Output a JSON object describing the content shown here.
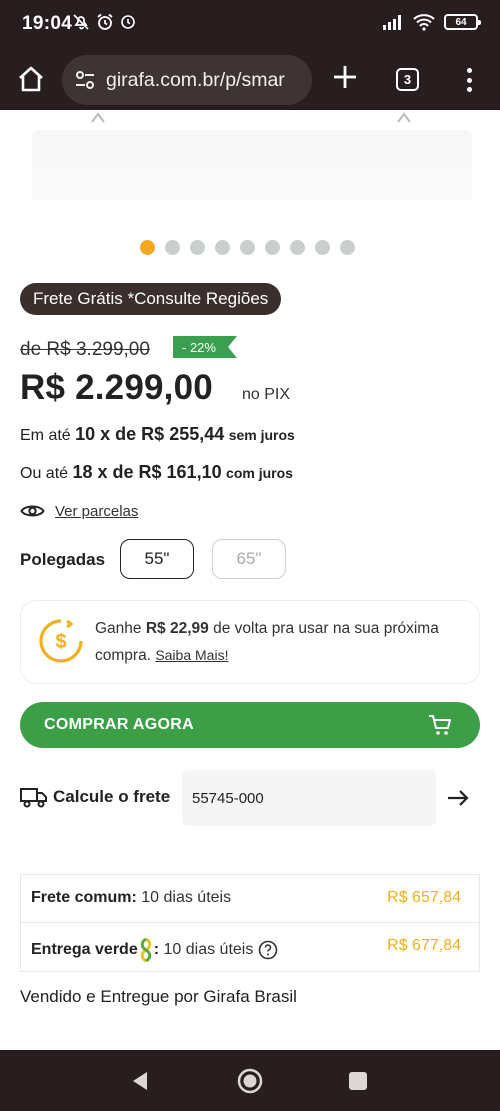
{
  "status_bar": {
    "time": "19:04",
    "battery": "64"
  },
  "browser": {
    "url": "girafa.com.br/p/smar",
    "tab_count": "3"
  },
  "product": {
    "carousel": {
      "dot_count": 9,
      "active_index": 0
    },
    "shipping_badge": "Frete Grátis *Consulte Regiões",
    "old_price": "de R$ 3.299,00",
    "discount": "- 22%",
    "price": "R$ 2.299,00",
    "price_suffix": "no PIX",
    "installments": [
      {
        "prefix": "Em até",
        "amount": "10 x de R$ 255,44",
        "suffix": "sem juros"
      },
      {
        "prefix": "Ou até",
        "amount": "18 x de R$ 161,10",
        "suffix": "com juros"
      }
    ],
    "see_installments": "Ver parcelas",
    "size_label": "Polegadas",
    "sizes": [
      {
        "label": "55\"",
        "selected": true
      },
      {
        "label": "65\"",
        "selected": false
      }
    ],
    "cashback": {
      "text_before": "Ganhe",
      "amount": "R$ 22,99",
      "text_after": "de volta pra usar na sua próxima compra.",
      "link": "Saiba Mais!"
    },
    "buy_button": "COMPRAR AGORA",
    "shipping_calc": {
      "label": "Calcule o frete",
      "cep_value": "55745-000"
    },
    "shipping_options": [
      {
        "name": "Frete comum:",
        "time": "10 dias úteis",
        "price": "R$ 657,84",
        "eco": false
      },
      {
        "name": "Entrega verde",
        "time": "10 dias úteis",
        "price": "R$ 677,84",
        "eco": true
      }
    ],
    "seller": "Vendido e Entregue por Girafa Brasil"
  },
  "colors": {
    "accent_green": "#3d9e48",
    "accent_orange": "#f5a623",
    "price_yellow": "#e8b21d",
    "chrome_bg": "#291e1f"
  }
}
